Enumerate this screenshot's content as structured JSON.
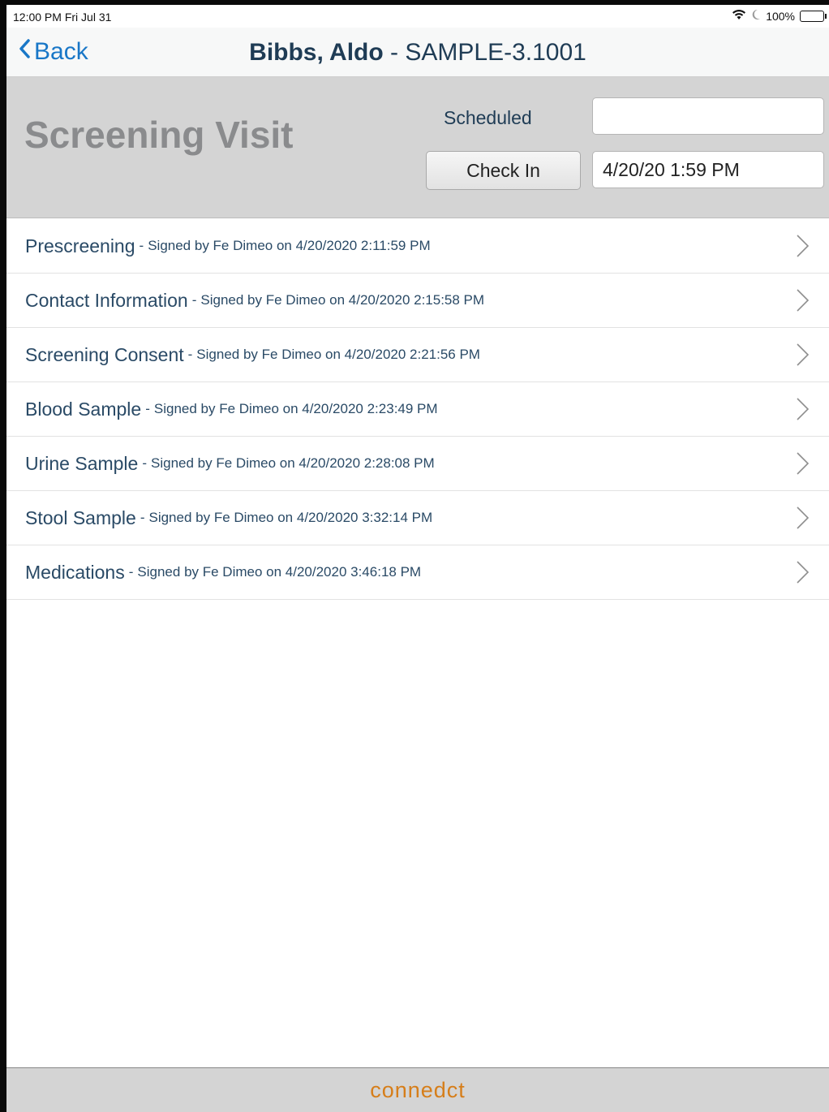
{
  "status_bar": {
    "time": "12:00 PM Fri Jul 31",
    "battery": "100%",
    "icons": [
      "wifi-icon",
      "moon-icon",
      "battery-icon"
    ]
  },
  "nav": {
    "back_label": "Back",
    "patient_name": "Bibbs, Aldo",
    "separator": " - ",
    "subject_id": "SAMPLE-3.1001"
  },
  "visit": {
    "title": "Screening Visit",
    "scheduled_label": "Scheduled",
    "scheduled_value": "",
    "checkin_label": "Check In",
    "checkin_value": "4/20/20 1:59 PM"
  },
  "forms": [
    {
      "name": "Prescreening",
      "signature": "Signed by Fe Dimeo on 4/20/2020 2:11:59 PM"
    },
    {
      "name": "Contact Information",
      "signature": "Signed by Fe Dimeo on 4/20/2020 2:15:58 PM"
    },
    {
      "name": "Screening Consent",
      "signature": "Signed by Fe Dimeo on 4/20/2020 2:21:56 PM"
    },
    {
      "name": "Blood Sample",
      "signature": "Signed by Fe Dimeo on 4/20/2020 2:23:49 PM"
    },
    {
      "name": "Urine Sample",
      "signature": "Signed by Fe Dimeo on 4/20/2020 2:28:08 PM"
    },
    {
      "name": "Stool Sample",
      "signature": "Signed by Fe Dimeo on 4/20/2020 3:32:14 PM"
    },
    {
      "name": "Medications",
      "signature": "Signed by Fe Dimeo on 4/20/2020 3:46:18 PM"
    }
  ],
  "form_separator": "-",
  "footer": {
    "logo_text": "connedct"
  },
  "colors": {
    "accent": "#1977c7",
    "title_text": "#1f3c55",
    "header_bg": "#d4d4d4",
    "logo": "#d67e1a"
  }
}
